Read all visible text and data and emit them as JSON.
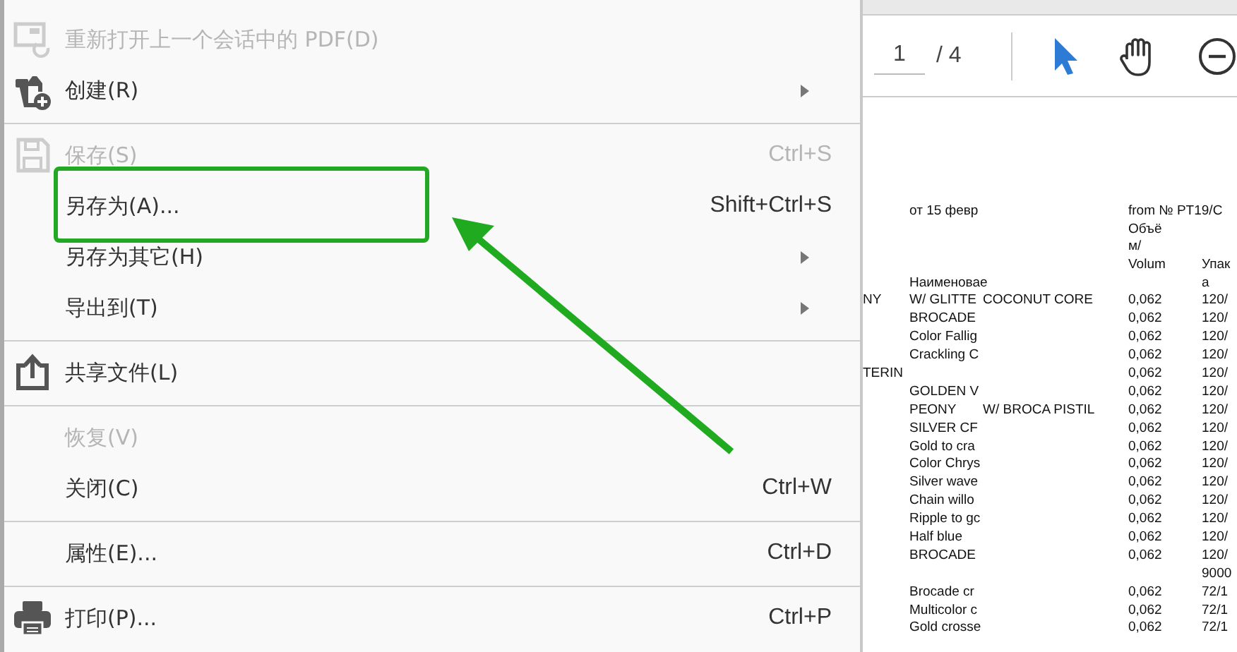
{
  "menu": {
    "items": [
      {
        "kind": "item",
        "label": "重新打开上一个会话中的 PDF(D)",
        "disabled": true,
        "submenu": false
      },
      {
        "kind": "item",
        "label": "创建(R)",
        "disabled": false,
        "submenu": true
      },
      {
        "kind": "separator"
      },
      {
        "kind": "item",
        "label": "保存(S)",
        "shortcut": "Ctrl+S",
        "disabled": true,
        "submenu": false
      },
      {
        "kind": "item",
        "label": "另存为(A)...",
        "shortcut": "Shift+Ctrl+S",
        "disabled": false,
        "submenu": false,
        "annotated": true
      },
      {
        "kind": "item",
        "label": "另存为其它(H)",
        "disabled": false,
        "submenu": true
      },
      {
        "kind": "item",
        "label": "导出到(T)",
        "disabled": false,
        "submenu": true
      },
      {
        "kind": "separator"
      },
      {
        "kind": "item",
        "label": "共享文件(L)",
        "disabled": false,
        "submenu": false
      },
      {
        "kind": "separator"
      },
      {
        "kind": "item",
        "label": "恢复(V)",
        "disabled": true,
        "submenu": false
      },
      {
        "kind": "item",
        "label": "关闭(C)",
        "shortcut": "Ctrl+W",
        "disabled": false,
        "submenu": false
      },
      {
        "kind": "separator"
      },
      {
        "kind": "item",
        "label": "属性(E)...",
        "shortcut": "Ctrl+D",
        "disabled": false,
        "submenu": false
      },
      {
        "kind": "separator"
      },
      {
        "kind": "item",
        "label": "打印(P)...",
        "shortcut": "Ctrl+P",
        "disabled": false,
        "submenu": false
      }
    ]
  },
  "toolbar": {
    "page_field": {
      "value": "1"
    },
    "page_total": "/ 4"
  },
  "document": {
    "header_lines": [
      {
        "column_2": "от 15 февр",
        "column_4": "from № PT19/C"
      },
      {
        "column_4": "Объё"
      },
      {
        "column_4": "м/"
      },
      {
        "column_4": "Volum",
        "column_5": "Упак"
      },
      {
        "column_2": "Наименовае",
        "column_5": "а"
      }
    ],
    "rows": [
      {
        "column_1": "NY",
        "column_2": "W/ GLITTE",
        "column_3": "COCONUT CORE",
        "column_4": "0,062",
        "column_5": "120/"
      },
      {
        "column_2": "BROCADE",
        "column_4": "0,062",
        "column_5": "120/"
      },
      {
        "column_2": "Color Fallig",
        "column_4": "0,062",
        "column_5": "120/"
      },
      {
        "column_2": "Crackling C",
        "column_4": "0,062",
        "column_5": "120/"
      },
      {
        "column_1": "TERIN",
        "column_4": "0,062",
        "column_5": "120/"
      },
      {
        "column_2": "GOLDEN V",
        "column_4": "0,062",
        "column_5": "120/"
      },
      {
        "column_2": "PEONY",
        "column_3": "W/ BROCA PISTIL",
        "column_4": "0,062",
        "column_5": "120/"
      },
      {
        "column_2": "SILVER CF",
        "column_4": "0,062",
        "column_5": "120/"
      },
      {
        "column_2": "Gold to cra",
        "column_4": "0,062",
        "column_5": "120/"
      },
      {
        "column_2": "Color Chrys",
        "column_4": "0,062",
        "column_5": "120/"
      },
      {
        "column_2": "Silver wave",
        "column_4": "0,062",
        "column_5": "120/"
      },
      {
        "column_2": "Chain willo",
        "column_4": "0,062",
        "column_5": "120/"
      },
      {
        "column_2": "Ripple to gc",
        "column_4": "0,062",
        "column_5": "120/"
      },
      {
        "column_2": "Half blue",
        "column_4": "0,062",
        "column_5": "120/"
      },
      {
        "column_2": "BROCADE",
        "column_4": "0,062",
        "column_5": "120/"
      },
      {
        "column_5": "9000"
      },
      {
        "column_2": "Brocade cr",
        "column_4": "0,062",
        "column_5": "72/1"
      },
      {
        "column_2": "Multicolor c",
        "column_4": "0,062",
        "column_5": "72/1"
      },
      {
        "column_2": "Gold crosse",
        "column_4": "0,062",
        "column_5": "72/1"
      }
    ]
  }
}
